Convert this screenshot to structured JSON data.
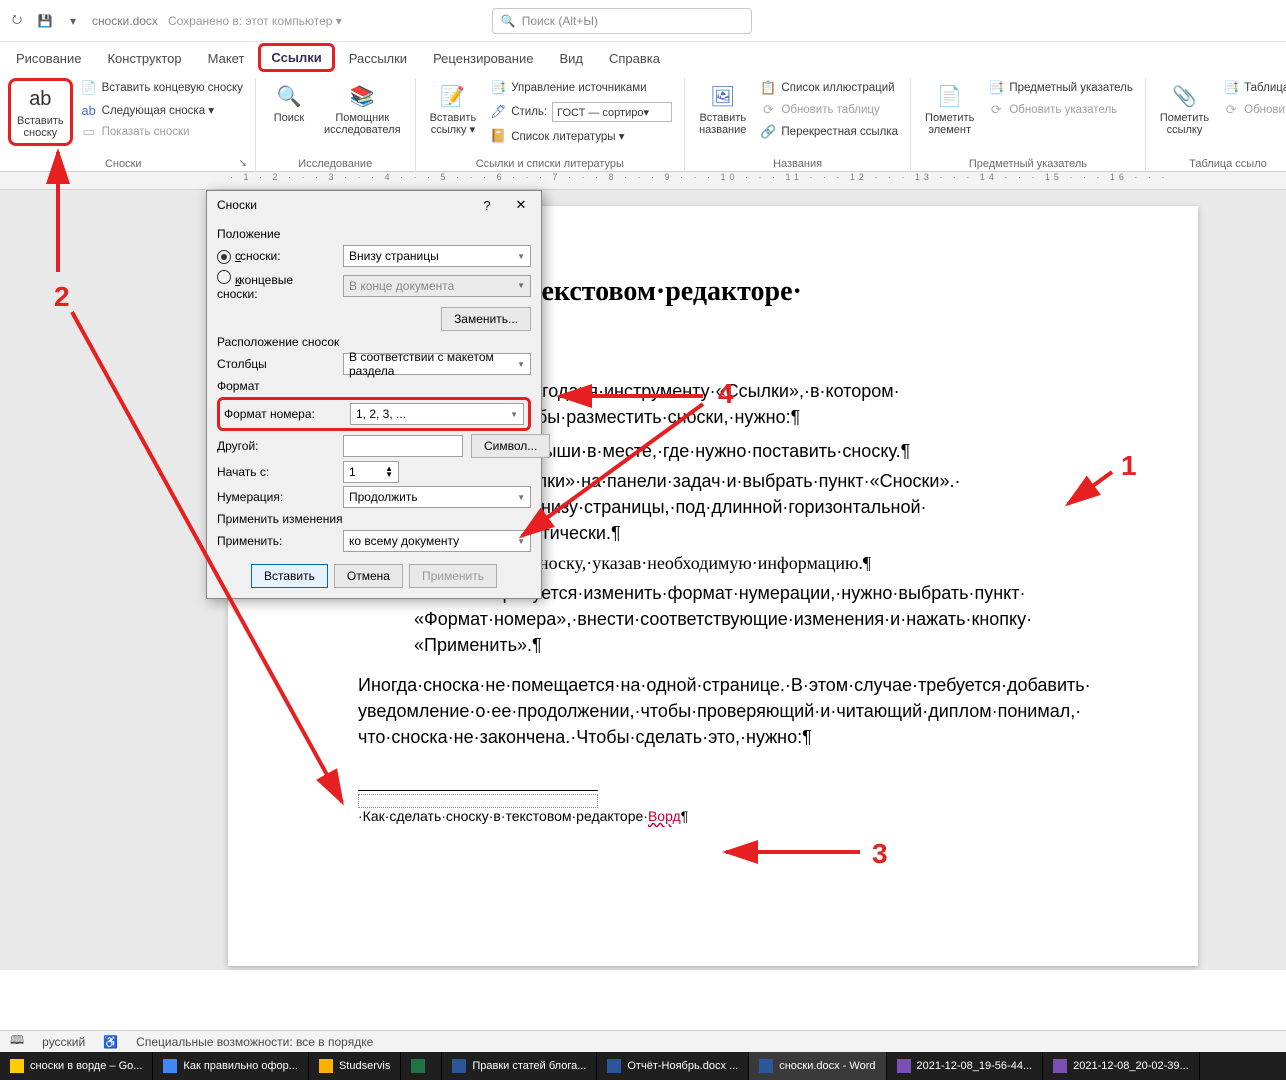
{
  "titlebar": {
    "doc": "сноски.docx",
    "saved": "Сохранено в: этот компьютер ▾",
    "search": "Поиск (Alt+Ы)"
  },
  "tabs": [
    "Рисование",
    "Конструктор",
    "Макет",
    "Ссылки",
    "Рассылки",
    "Рецензирование",
    "Вид",
    "Справка"
  ],
  "active_tab": "Ссылки",
  "ribbon": {
    "footnotes": {
      "insert": "Вставить\nсноску",
      "end": "Вставить концевую сноску",
      "next": "Следующая сноска ▾",
      "show": "Показать сноски",
      "title": "Сноски"
    },
    "research": {
      "search": "Поиск",
      "assistant": "Помощник\nисследователя",
      "title": "Исследование"
    },
    "citations": {
      "insert": "Вставить\nссылку ▾",
      "manage": "Управление источниками",
      "style_lbl": "Стиль:",
      "style_val": "ГОСТ — сортиро▾",
      "biblio": "Список литературы ▾",
      "title": "Ссылки и списки литературы"
    },
    "captions": {
      "insert": "Вставить\nназвание",
      "list": "Список иллюстраций",
      "update": "Обновить таблицу",
      "cross": "Перекрестная ссылка",
      "title": "Названия"
    },
    "index": {
      "mark": "Пометить\nэлемент",
      "idx": "Предметный указатель",
      "update": "Обновить указатель",
      "title": "Предметный указатель"
    },
    "toa": {
      "mark": "Пометить\nссылку",
      "toa": "Таблица с",
      "update": "Обновить",
      "title": "Таблица ссыло"
    }
  },
  "dialog": {
    "title": "Сноски",
    "sect_pos": "Положение",
    "opt_foot": "сноски:",
    "opt_foot_val": "Внизу страницы",
    "opt_end": "концевые сноски:",
    "opt_end_val": "В конце документа",
    "replace": "Заменить...",
    "sect_layout": "Расположение сносок",
    "cols": "Столбцы",
    "cols_val": "В соответствии с макетом раздела",
    "sect_fmt": "Формат",
    "fmt": "Формат номера:",
    "fmt_val": "1, 2, 3, ...",
    "other": "Другой:",
    "symbol": "Символ...",
    "start": "Начать с:",
    "start_val": "1",
    "numbering": "Нумерация:",
    "numbering_val": "Продолжить",
    "sect_apply": "Применить изменения",
    "apply_to": "Применить:",
    "apply_to_val": "ко всему документу",
    "btn_insert": "Вставить",
    "btn_cancel": "Отмена",
    "btn_apply": "Применить"
  },
  "doc": {
    "h1": "ать·сноску·в·текстовом·редакторе·",
    "p1a": "·довольно·просто·благодаря·инструменту·«Ссылки»,·в·котором·",
    "p1b": "носки».·Для·того,·чтобы·разместить·сноски,·нужно:¶",
    "li1": "евой·кнопкой·мыши·в·месте,·где·нужно·поставить·сноску.¶",
    "li2a": "·вкладку·«Ссылки»·на·панели·задач·и·выбрать·пункт·«Сноски».·",
    "li2b": "·установлена·внизу·страницы,·под·длинной·горизонтальной·",
    "li2c": "чертой,·автоматически.¶",
    "li3": "3.→Заполнить·сноску,·указав·необходимую·информацию.¶",
    "li4a": "4.→Если·требуется·изменить·формат·нумерации,·нужно·выбрать·пункт·",
    "li4b": "«Формат·номера»,·внести·соответствующие·изменения·и·нажать·кнопку·",
    "li4c": "«Применить».¶",
    "p2a": "Иногда·сноска·не·помещается·на·одной·странице.·В·этом·случае·требуется·добавить·",
    "p2b": "уведомление·о·ее·продолжении,·чтобы·проверяющий·и·читающий·диплом·понимал,·",
    "p2c": "что·сноска·не·закончена.·Чтобы·сделать·это,·нужно:¶",
    "ftn_pre": "·Как·сделать·сноску·в·текстовом·редакторе·",
    "ftn_w": "Ворд",
    "ftn_post": "¶"
  },
  "status": {
    "lang": "русский",
    "acc": "Специальные возможности: все в порядке"
  },
  "taskbar": [
    {
      "label": "сноски в ворде – Go...",
      "color": "#ffcc00"
    },
    {
      "label": "Как правильно офор...",
      "color": "#4285f4"
    },
    {
      "label": "Studservis",
      "color": "#ffb000"
    },
    {
      "label": "",
      "color": "#217346"
    },
    {
      "label": "Правки статей блога...",
      "color": "#2b579a"
    },
    {
      "label": "Отчёт-Ноябрь.docx ...",
      "color": "#2b579a"
    },
    {
      "label": "сноски.docx - Word",
      "color": "#2b579a",
      "active": true
    },
    {
      "label": "2021-12-08_19-56-44...",
      "color": "#7a4fb5"
    },
    {
      "label": "2021-12-08_20-02-39...",
      "color": "#7a4fb5"
    }
  ],
  "ann": {
    "n1": "1",
    "n2": "2",
    "n3": "3",
    "n4": "4"
  }
}
